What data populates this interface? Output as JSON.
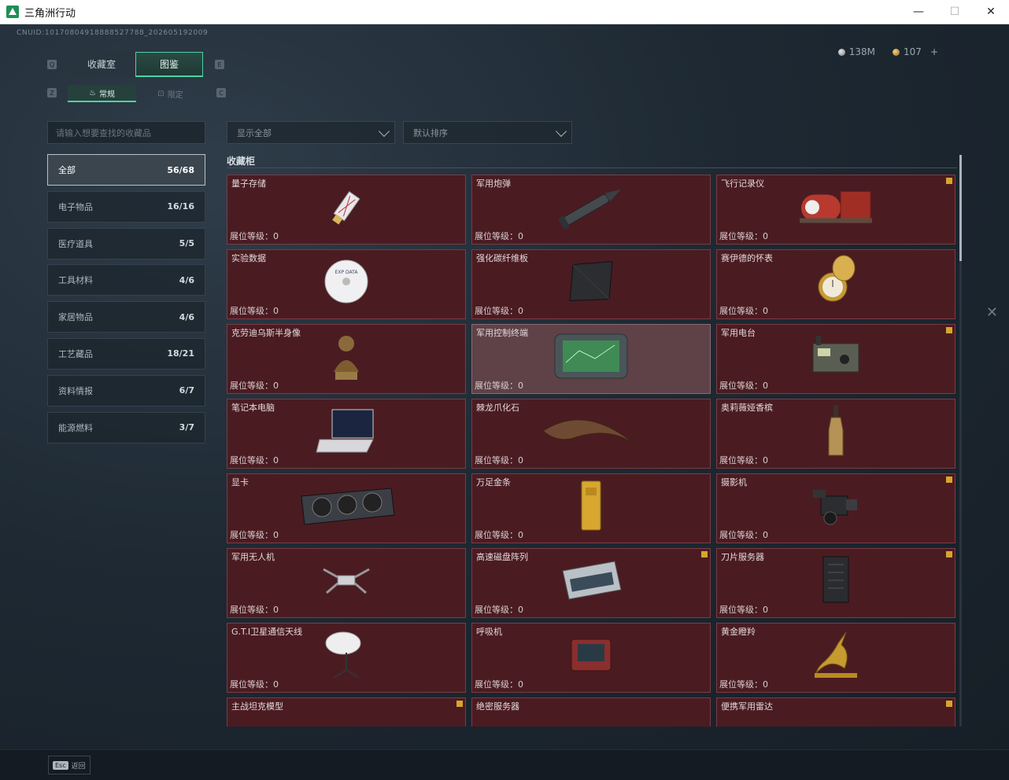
{
  "window": {
    "title": "三角洲行动",
    "min": "—",
    "max": "☐",
    "close": "✕"
  },
  "uid": "CNUID:10170804918888527788_202605192009",
  "currency": {
    "silver": "138M",
    "gold": "107",
    "add": "+"
  },
  "keyhints": {
    "q": "Q",
    "e": "E",
    "z": "Z",
    "c": "C"
  },
  "tabs": [
    {
      "label": "收藏室"
    },
    {
      "label": "图鉴"
    }
  ],
  "subtabs": [
    {
      "label": "常规",
      "icon": "flame-icon"
    },
    {
      "label": "限定",
      "icon": "gift-icon"
    }
  ],
  "search": {
    "placeholder": "请输入想要查找的收藏品"
  },
  "filters": {
    "show": "显示全部",
    "sort": "默认排序"
  },
  "categories": [
    {
      "label": "全部",
      "count": "56/68"
    },
    {
      "label": "电子物品",
      "count": "16/16"
    },
    {
      "label": "医疗道具",
      "count": "5/5"
    },
    {
      "label": "工具材料",
      "count": "4/6"
    },
    {
      "label": "家居物品",
      "count": "4/6"
    },
    {
      "label": "工艺藏品",
      "count": "18/21"
    },
    {
      "label": "资料情报",
      "count": "6/7"
    },
    {
      "label": "能源燃料",
      "count": "3/7"
    }
  ],
  "section_title": "收藏柜",
  "level_prefix": "展位等级：",
  "items": [
    {
      "name": "量子存储",
      "level": "0",
      "flag": false,
      "icon": "usb-drive-icon"
    },
    {
      "name": "军用炮弹",
      "level": "0",
      "flag": false,
      "icon": "shell-icon"
    },
    {
      "name": "飞行记录仪",
      "level": "0",
      "flag": true,
      "icon": "flight-recorder-icon"
    },
    {
      "name": "实验数据",
      "level": "0",
      "flag": false,
      "icon": "disc-icon"
    },
    {
      "name": "强化碳纤维板",
      "level": "0",
      "flag": false,
      "icon": "carbon-plate-icon"
    },
    {
      "name": "赛伊德的怀表",
      "level": "0",
      "flag": false,
      "icon": "pocket-watch-icon"
    },
    {
      "name": "克劳迪乌斯半身像",
      "level": "0",
      "flag": false,
      "icon": "bust-icon"
    },
    {
      "name": "军用控制终端",
      "level": "0",
      "flag": false,
      "icon": "terminal-icon",
      "dim": true
    },
    {
      "name": "军用电台",
      "level": "0",
      "flag": true,
      "icon": "radio-icon"
    },
    {
      "name": "笔记本电脑",
      "level": "0",
      "flag": false,
      "icon": "laptop-icon"
    },
    {
      "name": "棘龙爪化石",
      "level": "0",
      "flag": false,
      "icon": "claw-fossil-icon"
    },
    {
      "name": "奥莉薇娅香槟",
      "level": "0",
      "flag": false,
      "icon": "champagne-icon"
    },
    {
      "name": "显卡",
      "level": "0",
      "flag": false,
      "icon": "gpu-icon"
    },
    {
      "name": "万足金条",
      "level": "0",
      "flag": false,
      "icon": "gold-bar-icon"
    },
    {
      "name": "摄影机",
      "level": "0",
      "flag": true,
      "icon": "camera-icon"
    },
    {
      "name": "军用无人机",
      "level": "0",
      "flag": false,
      "icon": "drone-icon"
    },
    {
      "name": "高速磁盘阵列",
      "level": "0",
      "flag": true,
      "icon": "disk-array-icon"
    },
    {
      "name": "刀片服务器",
      "level": "0",
      "flag": true,
      "icon": "blade-server-icon"
    },
    {
      "name": "G.T.I卫星通信天线",
      "level": "0",
      "flag": false,
      "icon": "satellite-dish-icon"
    },
    {
      "name": "呼吸机",
      "level": "0",
      "flag": false,
      "icon": "ventilator-icon"
    },
    {
      "name": "黄金瞪羚",
      "level": "0",
      "flag": false,
      "icon": "gold-gazelle-icon"
    },
    {
      "name": "主战坦克模型",
      "level": "",
      "flag": true,
      "icon": "tank-model-icon"
    },
    {
      "name": "绝密服务器",
      "level": "",
      "flag": false,
      "icon": "secret-server-icon"
    },
    {
      "name": "便携军用雷达",
      "level": "",
      "flag": true,
      "icon": "radar-icon"
    }
  ],
  "bottom": {
    "key": "Esc",
    "label": "返回"
  }
}
